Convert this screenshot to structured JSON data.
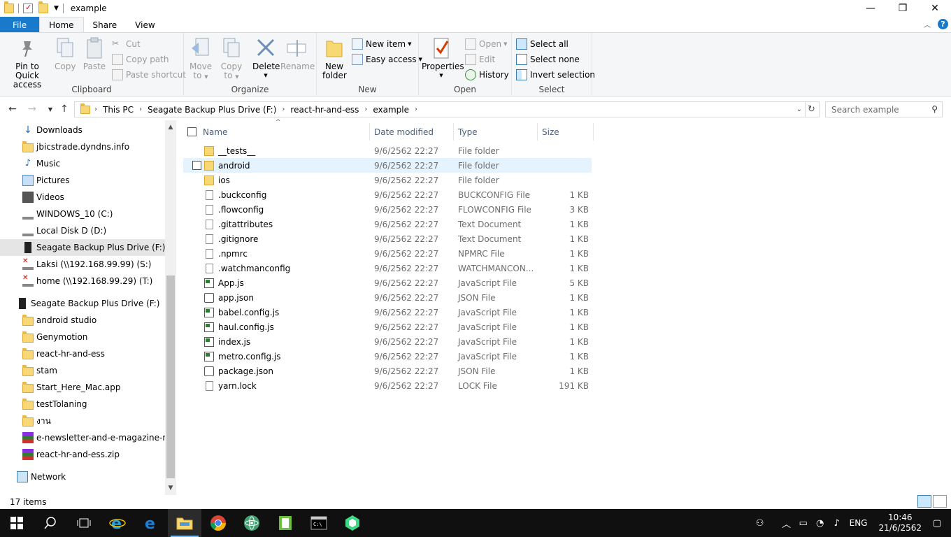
{
  "window": {
    "title": "example"
  },
  "ribbon_tabs": [
    "File",
    "Home",
    "Share",
    "View"
  ],
  "ribbon": {
    "clipboard": {
      "label": "Clipboard",
      "pin": "Pin to Quick access",
      "pin_l1": "Pin to Quick",
      "pin_l2": "access",
      "copy": "Copy",
      "paste": "Paste",
      "cut": "Cut",
      "copy_path": "Copy path",
      "paste_shortcut": "Paste shortcut"
    },
    "organize": {
      "label": "Organize",
      "move_l1": "Move",
      "move_l2": "to",
      "copy_l1": "Copy",
      "copy_l2": "to",
      "delete": "Delete",
      "rename": "Rename"
    },
    "new": {
      "label": "New",
      "folder_l1": "New",
      "folder_l2": "folder",
      "new_item": "New item",
      "easy_access": "Easy access"
    },
    "open": {
      "label": "Open",
      "properties": "Properties",
      "open": "Open",
      "edit": "Edit",
      "history": "History"
    },
    "select": {
      "label": "Select",
      "select_all": "Select all",
      "select_none": "Select none",
      "invert": "Invert selection"
    }
  },
  "address": {
    "crumbs": [
      "This PC",
      "Seagate Backup Plus Drive (F:)",
      "react-hr-and-ess",
      "example"
    ],
    "search_placeholder": "Search example"
  },
  "nav_pane": {
    "items": [
      {
        "label": "Downloads",
        "icon": "download-icon"
      },
      {
        "label": "jbicstrade.dyndns.info",
        "icon": "folder-icon"
      },
      {
        "label": "Music",
        "icon": "music-icon"
      },
      {
        "label": "Pictures",
        "icon": "pictures-icon"
      },
      {
        "label": "Videos",
        "icon": "videos-icon"
      },
      {
        "label": "WINDOWS_10 (C:)",
        "icon": "drive-icon"
      },
      {
        "label": "Local Disk D (D:)",
        "icon": "drive-icon"
      },
      {
        "label": "Seagate Backup Plus Drive (F:)",
        "icon": "usb-drive-icon"
      },
      {
        "label": "Laksi (\\\\192.168.99.99) (S:)",
        "icon": "network-drive-disconnected-icon"
      },
      {
        "label": "home (\\\\192.168.99.29) (T:)",
        "icon": "network-drive-disconnected-icon"
      },
      {
        "label": "Seagate Backup Plus Drive (F:)",
        "icon": "usb-drive-icon"
      },
      {
        "label": "android studio",
        "icon": "folder-icon"
      },
      {
        "label": "Genymotion",
        "icon": "folder-icon"
      },
      {
        "label": "react-hr-and-ess",
        "icon": "folder-icon"
      },
      {
        "label": "stam",
        "icon": "folder-icon"
      },
      {
        "label": "Start_Here_Mac.app",
        "icon": "folder-icon"
      },
      {
        "label": "testTolaning",
        "icon": "folder-icon"
      },
      {
        "label": "งาน",
        "icon": "folder-icon"
      },
      {
        "label": "e-newsletter-and-e-magazine-mas",
        "icon": "archive-icon"
      },
      {
        "label": "react-hr-and-ess.zip",
        "icon": "archive-icon"
      },
      {
        "label": "Network",
        "icon": "network-icon"
      }
    ]
  },
  "columns": {
    "name": "Name",
    "date": "Date modified",
    "type": "Type",
    "size": "Size"
  },
  "files": [
    {
      "name": "__tests__",
      "date": "9/6/2562 22:27",
      "type": "File folder",
      "size": "",
      "icon": "folder"
    },
    {
      "name": "android",
      "date": "9/6/2562 22:27",
      "type": "File folder",
      "size": "",
      "icon": "folder"
    },
    {
      "name": "ios",
      "date": "9/6/2562 22:27",
      "type": "File folder",
      "size": "",
      "icon": "folder"
    },
    {
      "name": ".buckconfig",
      "date": "9/6/2562 22:27",
      "type": "BUCKCONFIG File",
      "size": "1 KB",
      "icon": "file"
    },
    {
      "name": ".flowconfig",
      "date": "9/6/2562 22:27",
      "type": "FLOWCONFIG File",
      "size": "3 KB",
      "icon": "file"
    },
    {
      "name": ".gitattributes",
      "date": "9/6/2562 22:27",
      "type": "Text Document",
      "size": "1 KB",
      "icon": "file"
    },
    {
      "name": ".gitignore",
      "date": "9/6/2562 22:27",
      "type": "Text Document",
      "size": "1 KB",
      "icon": "file"
    },
    {
      "name": ".npmrc",
      "date": "9/6/2562 22:27",
      "type": "NPMRC File",
      "size": "1 KB",
      "icon": "file"
    },
    {
      "name": ".watchmanconfig",
      "date": "9/6/2562 22:27",
      "type": "WATCHMANCON...",
      "size": "1 KB",
      "icon": "file"
    },
    {
      "name": "App.js",
      "date": "9/6/2562 22:27",
      "type": "JavaScript File",
      "size": "5 KB",
      "icon": "js"
    },
    {
      "name": "app.json",
      "date": "9/6/2562 22:27",
      "type": "JSON File",
      "size": "1 KB",
      "icon": "json"
    },
    {
      "name": "babel.config.js",
      "date": "9/6/2562 22:27",
      "type": "JavaScript File",
      "size": "1 KB",
      "icon": "js"
    },
    {
      "name": "haul.config.js",
      "date": "9/6/2562 22:27",
      "type": "JavaScript File",
      "size": "1 KB",
      "icon": "js"
    },
    {
      "name": "index.js",
      "date": "9/6/2562 22:27",
      "type": "JavaScript File",
      "size": "1 KB",
      "icon": "js"
    },
    {
      "name": "metro.config.js",
      "date": "9/6/2562 22:27",
      "type": "JavaScript File",
      "size": "1 KB",
      "icon": "js"
    },
    {
      "name": "package.json",
      "date": "9/6/2562 22:27",
      "type": "JSON File",
      "size": "1 KB",
      "icon": "json"
    },
    {
      "name": "yarn.lock",
      "date": "9/6/2562 22:27",
      "type": "LOCK File",
      "size": "191 KB",
      "icon": "file"
    }
  ],
  "status": {
    "item_count": "17 items"
  },
  "taskbar": {
    "apps": [
      "start-icon",
      "search-icon",
      "task-view-icon",
      "internet-explorer-icon",
      "edge-icon",
      "file-explorer-icon",
      "chrome-icon",
      "atom-icon",
      "app-green-icon",
      "terminal-icon",
      "android-studio-icon"
    ],
    "lang": "ENG",
    "time": "10:46",
    "date": "21/6/2562"
  },
  "colors": {
    "accent": "#1979ca",
    "selection": "#cce8ff",
    "hover": "#e5f3ff",
    "folder": "#f8d775"
  }
}
